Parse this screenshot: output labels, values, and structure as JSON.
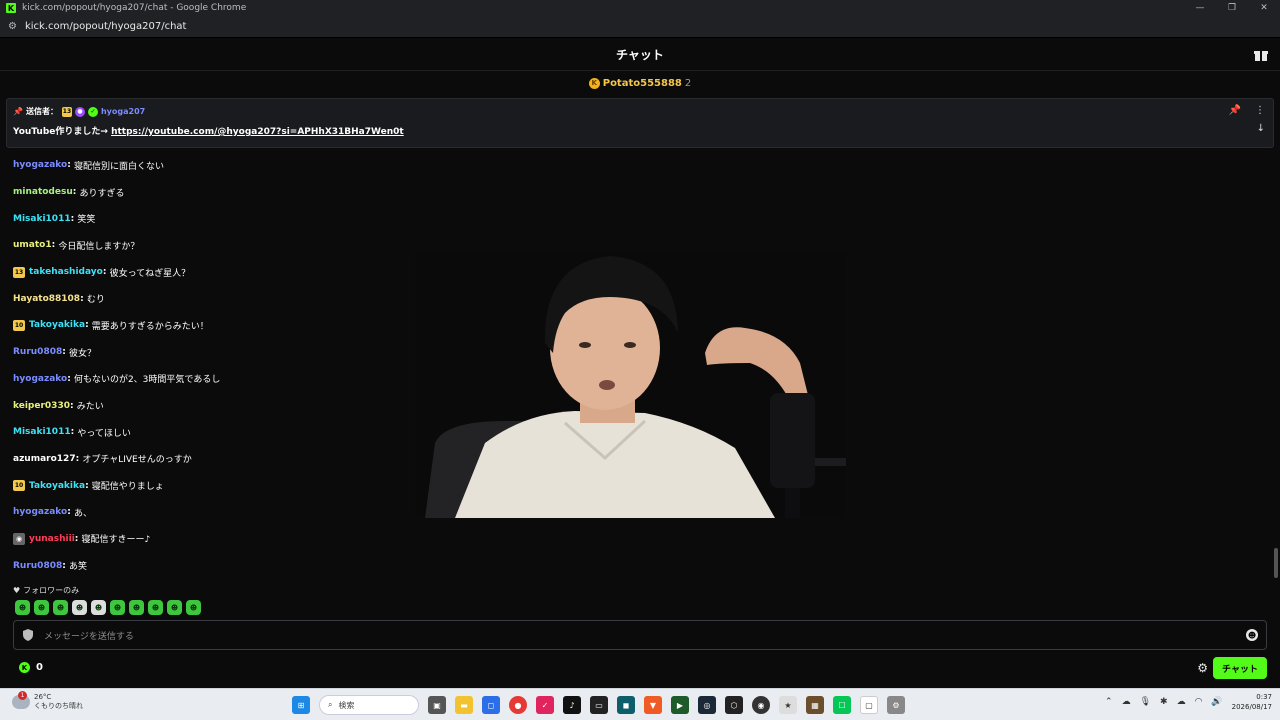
{
  "window": {
    "title": "kick.com/popout/hyoga207/chat - Google Chrome",
    "url": "kick.com/popout/hyoga207/chat"
  },
  "header": {
    "title": "チャット"
  },
  "gifter": {
    "name": "Potato555888",
    "count": "2"
  },
  "pinned": {
    "label": "送信者：",
    "sub_months": "13",
    "username": "hyoga207",
    "text": "YouTube作りました→ ",
    "link": "https://youtube.com/@hyoga207?si=APHhX31BHa7Wen0t"
  },
  "messages": [
    {
      "user": "hyogazako",
      "color": "#7b8cff",
      "text": "寝配信別に面白くない",
      "badge": ""
    },
    {
      "user": "minatodesu",
      "color": "#a4f27e",
      "text": "ありすぎる",
      "badge": ""
    },
    {
      "user": "Misaki1011",
      "color": "#3de1f5",
      "text": "笑笑",
      "badge": ""
    },
    {
      "user": "umato1",
      "color": "#e8f07a",
      "text": "今日配信しますか？",
      "badge": ""
    },
    {
      "user": "takehashidayo",
      "color": "#3de1f5",
      "text": "彼女ってねぎ星人？",
      "badge": "13"
    },
    {
      "user": "Hayato88108",
      "color": "#f5e28c",
      "text": "むり",
      "badge": ""
    },
    {
      "user": "Takoyakika",
      "color": "#3de1f5",
      "text": "需要ありすぎるからみたい！",
      "badge": "10"
    },
    {
      "user": "Ruru0808",
      "color": "#7b8cff",
      "text": "彼女？",
      "badge": ""
    },
    {
      "user": "hyogazako",
      "color": "#7b8cff",
      "text": "何もないのが2、3時間平気であるし",
      "badge": ""
    },
    {
      "user": "keiper0330",
      "color": "#e8f07a",
      "text": "みたい",
      "badge": ""
    },
    {
      "user": "Misaki1011",
      "color": "#3de1f5",
      "text": "やってほしい",
      "badge": ""
    },
    {
      "user": "azumaro127",
      "color": "#ffffff",
      "text": "オプチャLIVEせんのっすか",
      "badge": ""
    },
    {
      "user": "Takoyakika",
      "color": "#3de1f5",
      "text": "寝配信やりましょ",
      "badge": "10"
    },
    {
      "user": "hyogazako",
      "color": "#7b8cff",
      "text": "あ、",
      "badge": ""
    },
    {
      "user": "yunashiii",
      "color": "#ff3b5c",
      "text": "寝配信すきーー♪",
      "badge": "avatar"
    },
    {
      "user": "Ruru0808",
      "color": "#7b8cff",
      "text": "あ笑",
      "badge": ""
    }
  ],
  "follower_only": "フォロワーのみ",
  "input": {
    "placeholder": "メッセージを送信する"
  },
  "points": "0",
  "chat_button": "チャット",
  "taskbar": {
    "temperature": "26°C",
    "weather": "くもりのち晴れ",
    "search": "検索",
    "time": "0:37",
    "date": "2026/08/17"
  },
  "colors": {
    "accent": "#53fc18",
    "background": "#0b0b0c"
  }
}
